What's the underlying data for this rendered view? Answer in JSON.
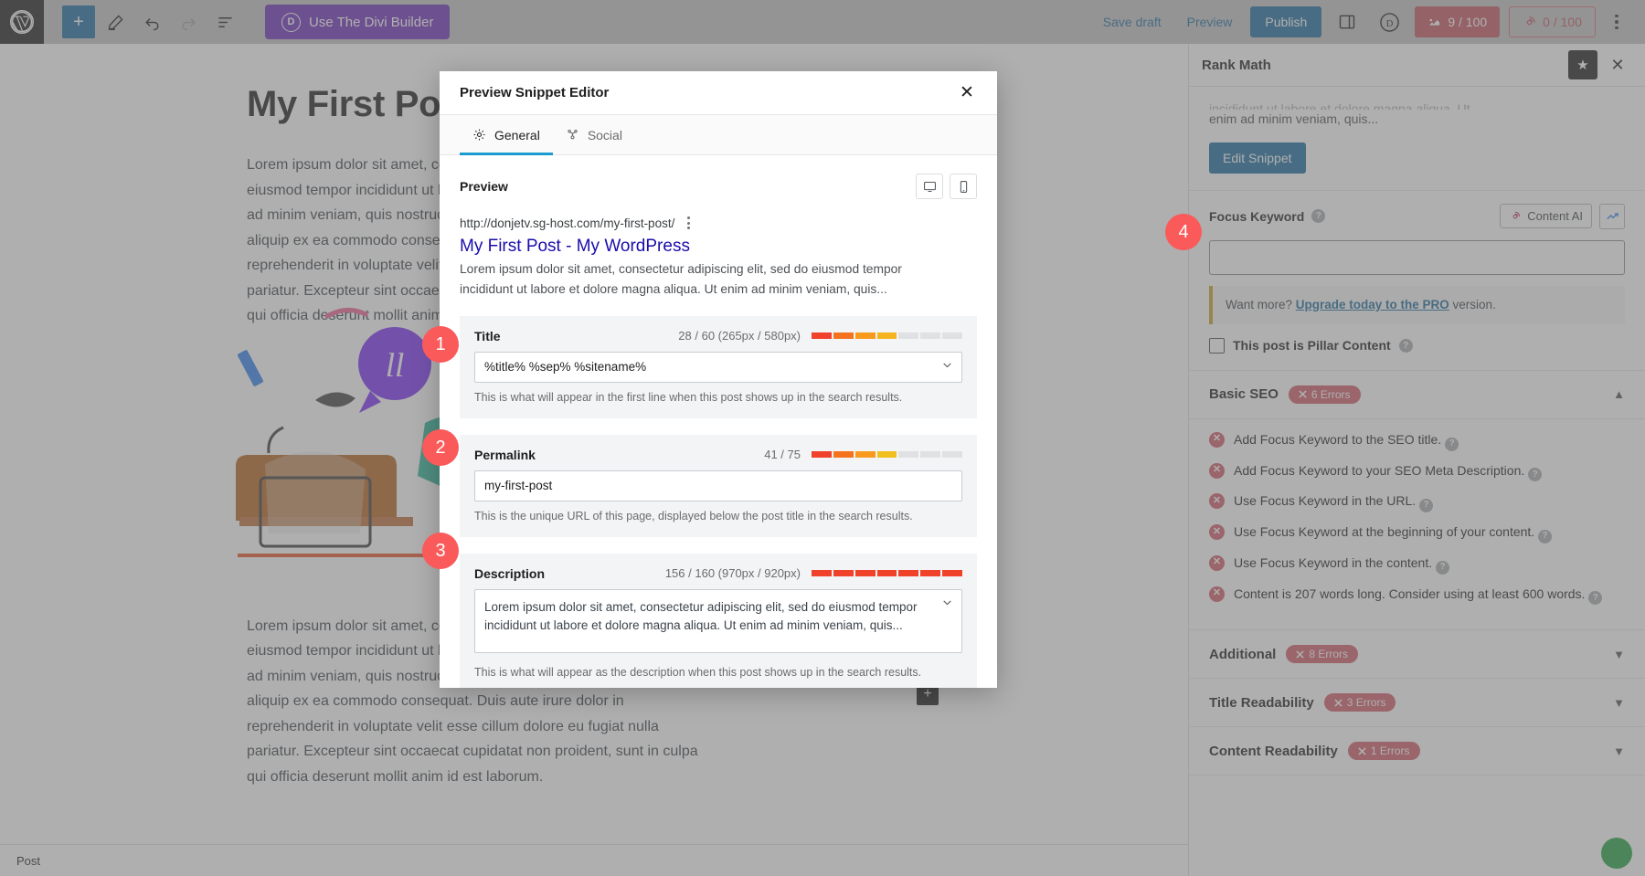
{
  "topbar": {
    "wp_logo": "wordpress-logo",
    "add_label": "+",
    "divi_label": "Use The Divi Builder",
    "divi_badge": "D",
    "save_draft": "Save draft",
    "preview": "Preview",
    "publish": "Publish",
    "divi_icon_label": "D",
    "seo_score": "9 / 100",
    "readability_score": "0 / 100"
  },
  "canvas": {
    "post_title": "My First Post",
    "paragraphs": [
      "Lorem ipsum dolor sit amet, consectetur adipiscing elit, sed do eiusmod tempor incididunt ut labore et dolore magna aliqua. Ut enim ad minim veniam, quis nostrud exercitation ullamco laboris nisi ut aliquip ex ea commodo consequat. Duis aute irure dolor in reprehenderit in voluptate velit esse cillum dolore eu fugiat nulla pariatur. Excepteur sint occaecat cupidatat non proident, sunt in culpa qui officia deserunt mollit anim id est laborum.",
      "Lorem ipsum dolor sit amet, consectetur adipiscing elit, sed do eiusmod tempor incididunt ut labore et dolore magna aliqua. Ut enim ad minim veniam, quis nostrud exercitation ullamco laboris nisi ut aliquip ex ea commodo consequat. Duis aute irure dolor in reprehenderit in voluptate velit esse cillum dolore eu fugiat nulla pariatur. Excepteur sint occaecat cupidatat non proident, sunt in culpa qui officia deserunt mollit anim id est laborum."
    ],
    "status_label": "Post",
    "add_block_label": "+"
  },
  "modal": {
    "title": "Preview Snippet Editor",
    "close_label": "✕",
    "tabs": [
      {
        "label": "General",
        "icon": "gear-icon",
        "active": true
      },
      {
        "label": "Social",
        "icon": "share-nodes-icon",
        "active": false
      }
    ],
    "preview_label": "Preview",
    "serp": {
      "url": "http://donjetv.sg-host.com/my-first-post/",
      "title": "My First Post - My WordPress",
      "description": "Lorem ipsum dolor sit amet, consectetur adipiscing elit, sed do eiusmod tempor incididunt ut labore et dolore magna aliqua. Ut enim ad minim veniam, quis..."
    },
    "fields": [
      {
        "label": "Title",
        "counter": "28 / 60 (265px / 580px)",
        "value": "%title% %sep% %sitename%",
        "hint": "This is what will appear in the first line when this post shows up in the search results.",
        "type": "select",
        "bars": [
          "#f0412a",
          "#f78d1e",
          "#f5a623",
          "#dfe1e3",
          "#dfe1e3",
          "#dfe1e3",
          "#dfe1e3"
        ]
      },
      {
        "label": "Permalink",
        "counter": "41 / 75",
        "value": "my-first-post",
        "hint": "This is the unique URL of this page, displayed below the post title in the search results.",
        "type": "text",
        "bars": [
          "#f0412a",
          "#f78d1e",
          "#f5c518",
          "#dfe1e3",
          "#dfe1e3",
          "#dfe1e3",
          "#dfe1e3"
        ]
      },
      {
        "label": "Description",
        "counter": "156 / 160 (970px / 920px)",
        "value": "Lorem ipsum dolor sit amet, consectetur adipiscing elit, sed do eiusmod tempor incididunt ut labore et dolore magna aliqua. Ut enim ad minim veniam, quis...",
        "hint": "This is what will appear as the description when this post shows up in the search results.",
        "type": "textarea",
        "bars": [
          "#f0412a",
          "#f0412a",
          "#f0412a",
          "#f0412a",
          "#f0412a",
          "#f0412a",
          "#f0412a"
        ]
      }
    ]
  },
  "sidebar": {
    "title": "Rank Math",
    "close_label": "✕",
    "snippet_clipped": "incididunt ut labore et dolore magna aliqua. Ut",
    "snippet_tail": "enim ad minim veniam, quis...",
    "edit_snippet": "Edit Snippet",
    "focus_keyword_label": "Focus Keyword",
    "content_ai_label": "Content AI",
    "focus_keyword_value": "",
    "notice_prefix": "Want more? ",
    "notice_link": "Upgrade today to the PRO",
    "notice_suffix": " version.",
    "pillar_label": "This post is Pillar Content",
    "accordions": [
      {
        "title": "Basic SEO",
        "badge": "6 Errors",
        "expanded": true
      },
      {
        "title": "Additional",
        "badge": "8 Errors",
        "expanded": false
      },
      {
        "title": "Title Readability",
        "badge": "3 Errors",
        "expanded": false
      },
      {
        "title": "Content Readability",
        "badge": "1 Errors",
        "expanded": false
      }
    ],
    "basic_seo_issues": [
      "Add Focus Keyword to the SEO title.",
      "Add Focus Keyword to your SEO Meta Description.",
      "Use Focus Keyword in the URL.",
      "Use Focus Keyword at the beginning of your content.",
      "Use Focus Keyword in the content.",
      "Content is 207 words long. Consider using at least 600 words."
    ]
  },
  "callouts": [
    {
      "number": "1"
    },
    {
      "number": "2"
    },
    {
      "number": "3"
    },
    {
      "number": "4"
    }
  ],
  "colors": {
    "accent_blue": "#1c6a9e",
    "divi_purple": "#6d2eb8",
    "error_red": "#d05c68",
    "badge_red": "#fa5a5a",
    "tab_underline": "#1c9bd1"
  }
}
